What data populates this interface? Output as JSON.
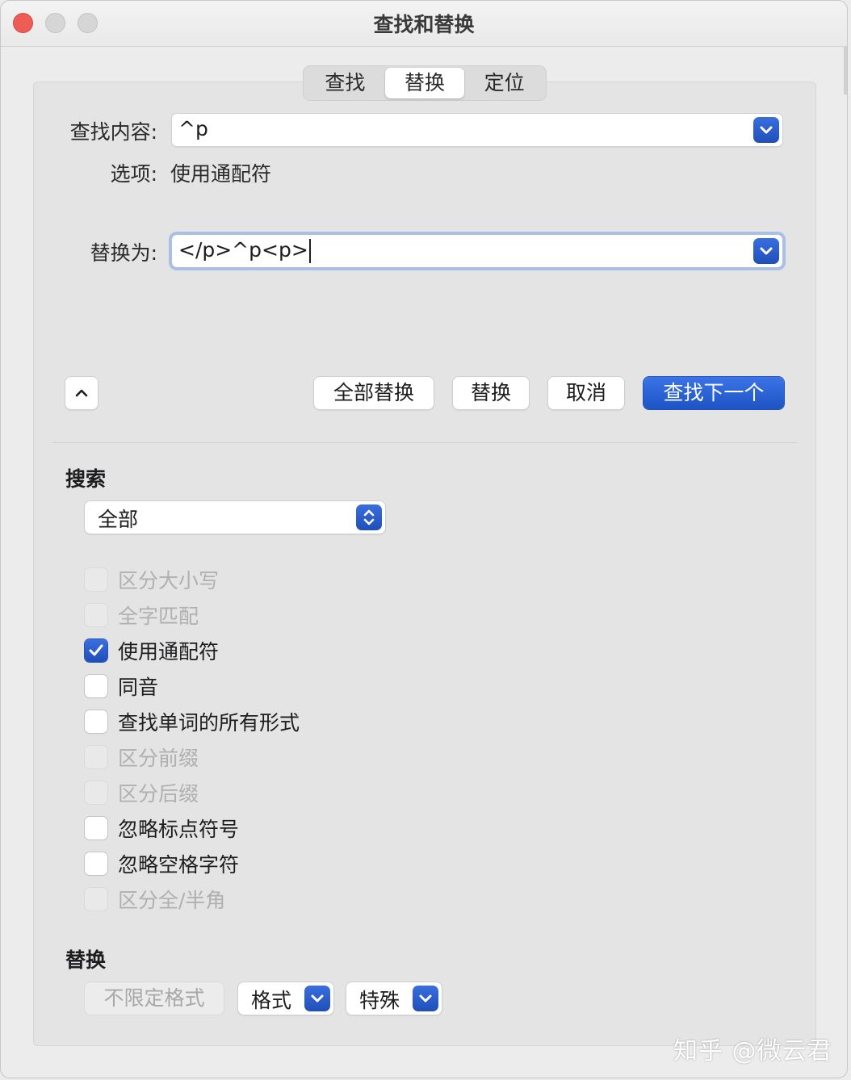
{
  "window": {
    "title": "查找和替换"
  },
  "tabs": [
    {
      "label": "查找",
      "active": false
    },
    {
      "label": "替换",
      "active": true
    },
    {
      "label": "定位",
      "active": false
    }
  ],
  "find": {
    "label": "查找内容:",
    "value": "^p"
  },
  "options": {
    "label": "选项:",
    "value": "使用通配符"
  },
  "replace": {
    "label": "替换为:",
    "value": "</p>^p<p>"
  },
  "buttons": {
    "collapse_icon": "chevron-up-icon",
    "replace_all": "全部替换",
    "replace": "替换",
    "cancel": "取消",
    "find_next": "查找下一个"
  },
  "search": {
    "title": "搜索",
    "scope": "全部",
    "checkboxes": [
      {
        "label": "区分大小写",
        "checked": false,
        "enabled": false
      },
      {
        "label": "全字匹配",
        "checked": false,
        "enabled": false
      },
      {
        "label": "使用通配符",
        "checked": true,
        "enabled": true
      },
      {
        "label": "同音",
        "checked": false,
        "enabled": true
      },
      {
        "label": "查找单词的所有形式",
        "checked": false,
        "enabled": true
      },
      {
        "label": "区分前缀",
        "checked": false,
        "enabled": false
      },
      {
        "label": "区分后缀",
        "checked": false,
        "enabled": false
      },
      {
        "label": "忽略标点符号",
        "checked": false,
        "enabled": true
      },
      {
        "label": "忽略空格字符",
        "checked": false,
        "enabled": true
      },
      {
        "label": "区分全/半角",
        "checked": false,
        "enabled": false
      }
    ]
  },
  "replace_section": {
    "title": "替换",
    "no_format": "不限定格式",
    "format": "格式",
    "special": "特殊"
  },
  "watermark": "知乎 @微云君",
  "colors": {
    "accent": "#2a5fd0",
    "close": "#ee5d55"
  }
}
